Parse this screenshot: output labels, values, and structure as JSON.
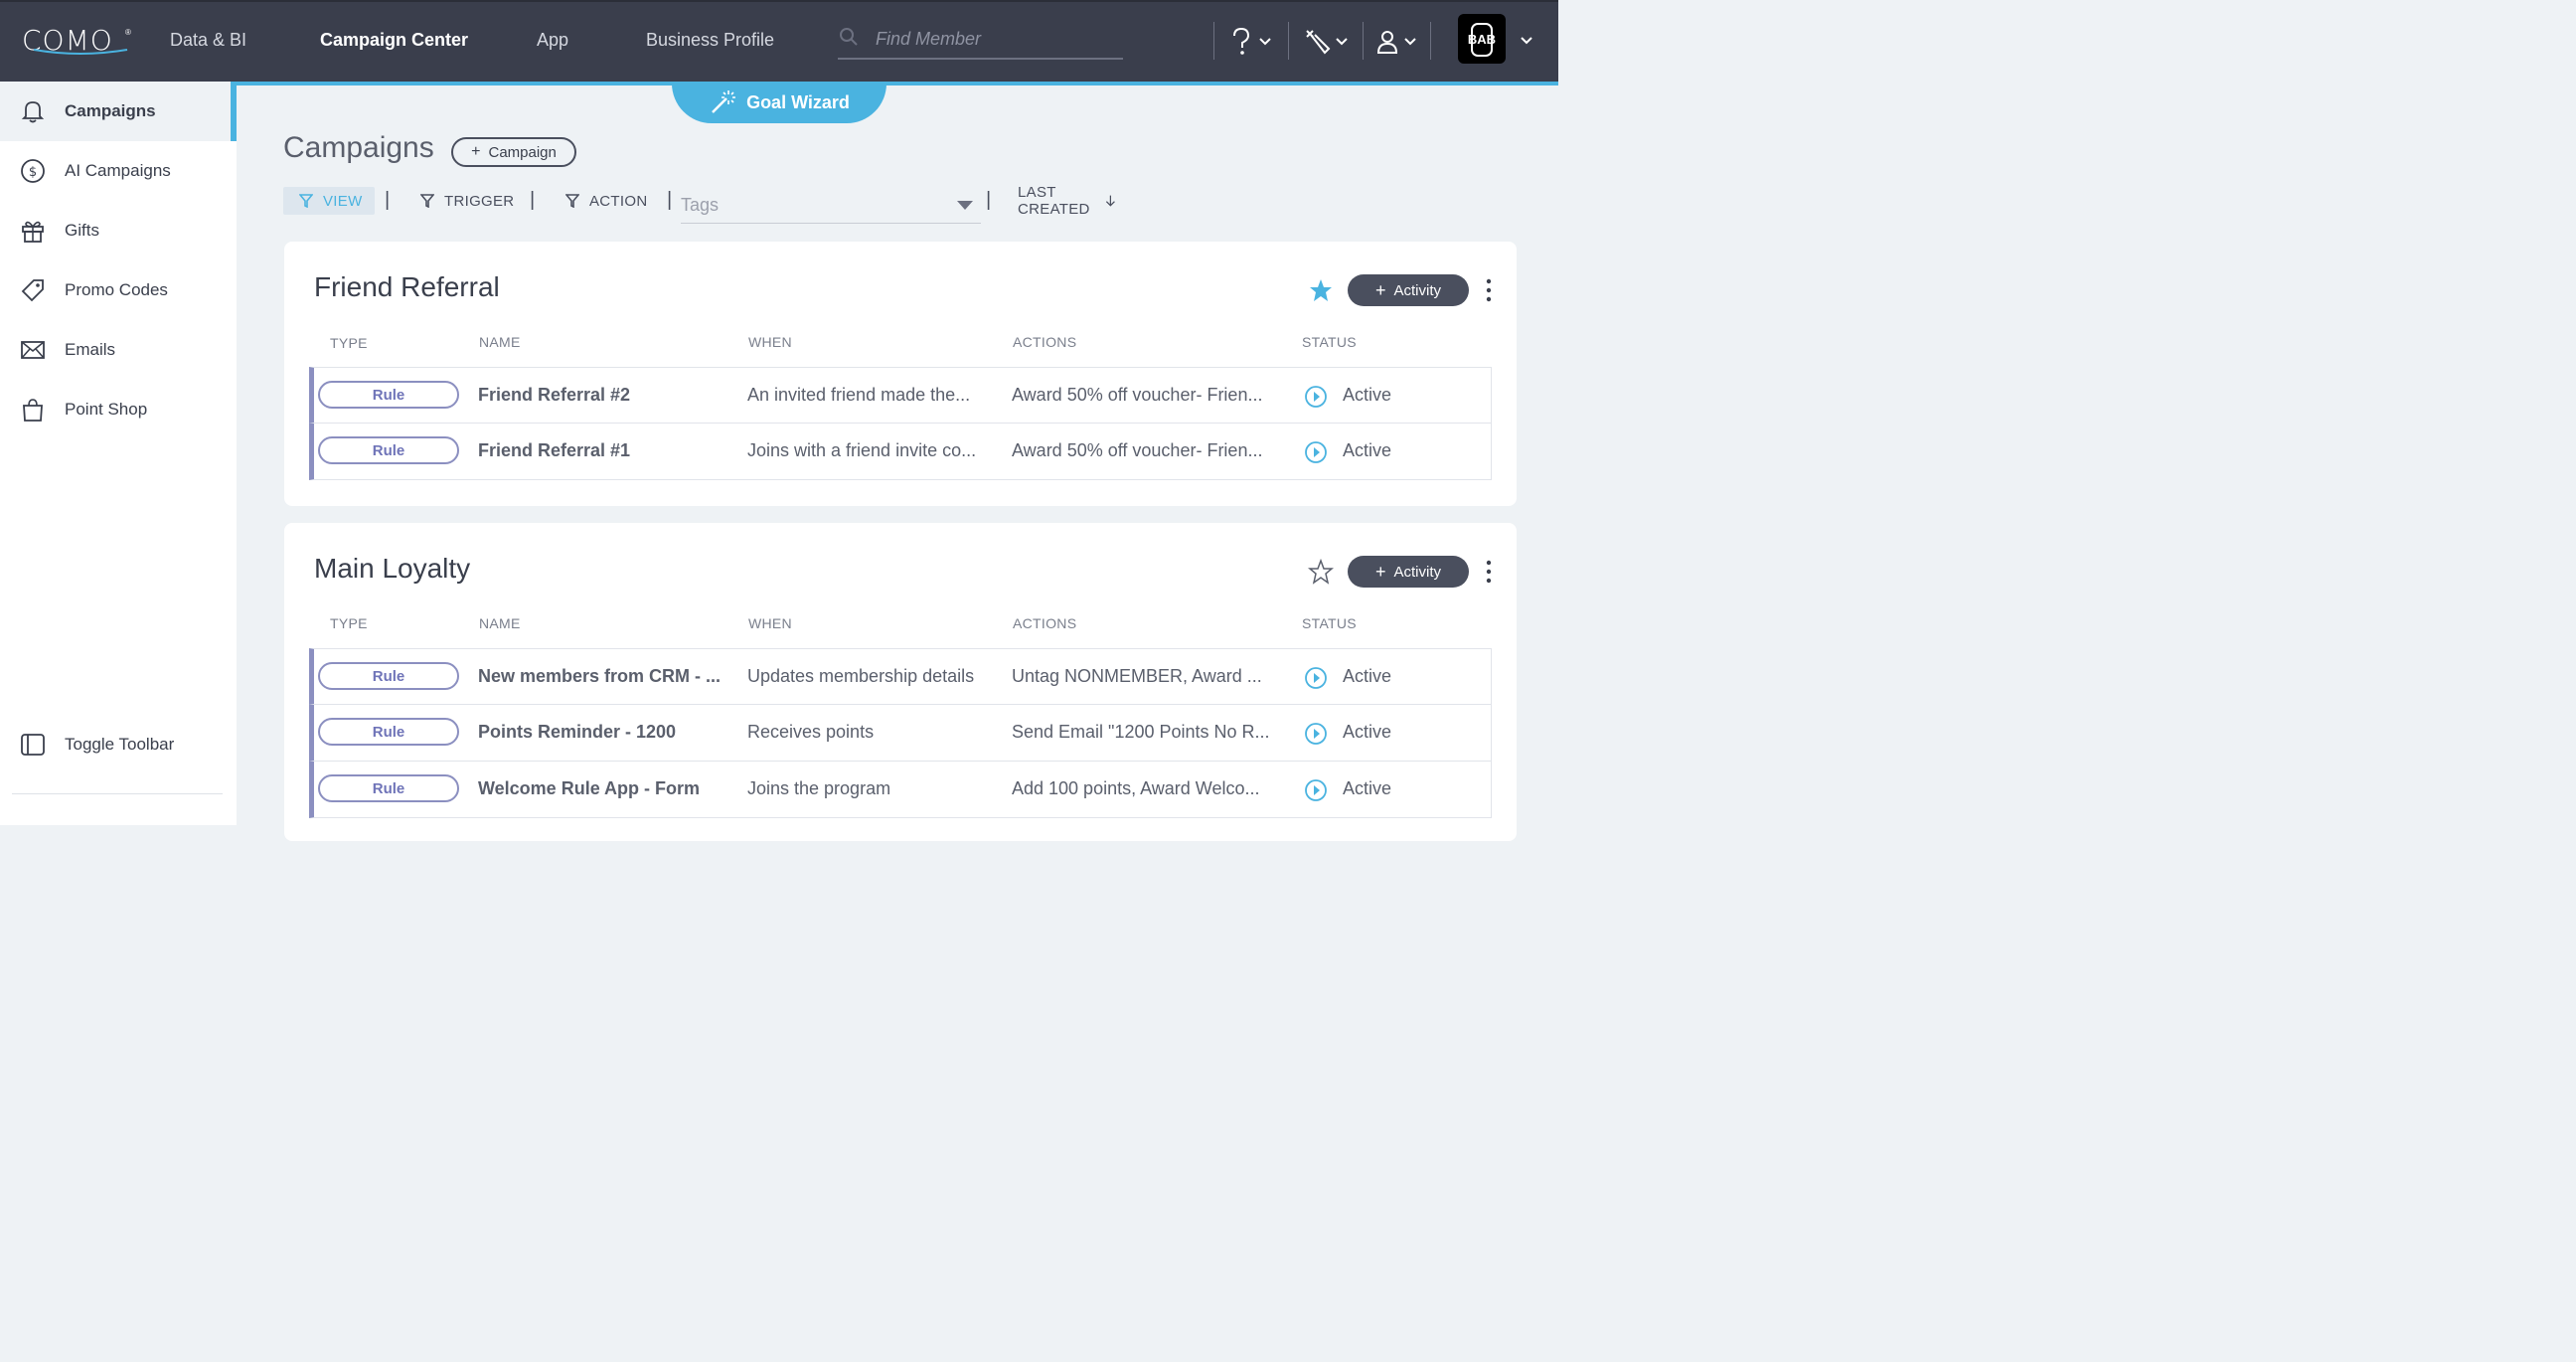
{
  "brand": {
    "logo": "COMO",
    "reg": "®",
    "account_badge": "BAB"
  },
  "nav": {
    "items": [
      {
        "label": "Data & BI"
      },
      {
        "label": "Campaign Center"
      },
      {
        "label": "App"
      },
      {
        "label": "Business Profile"
      }
    ],
    "search_placeholder": "Find Member",
    "icons": [
      "help-icon",
      "tools-icon",
      "user-icon"
    ]
  },
  "sidebar": {
    "items": [
      {
        "label": "Campaigns",
        "icon": "bell-icon"
      },
      {
        "label": "AI Campaigns",
        "icon": "dollar-circle-icon"
      },
      {
        "label": "Gifts",
        "icon": "gift-icon"
      },
      {
        "label": "Promo Codes",
        "icon": "tag-icon"
      },
      {
        "label": "Emails",
        "icon": "envelope-icon"
      },
      {
        "label": "Point Shop",
        "icon": "shopping-bag-icon"
      }
    ],
    "toggle_label": "Toggle Toolbar"
  },
  "goal_wizard": {
    "label": "Goal Wizard"
  },
  "page": {
    "title": "Campaigns",
    "add_button": "Campaign",
    "filters": {
      "view": "VIEW",
      "trigger": "TRIGGER",
      "action": "ACTION",
      "tags_placeholder": "Tags",
      "sort": "LAST CREATED"
    }
  },
  "columns": {
    "type": "TYPE",
    "name": "NAME",
    "when": "WHEN",
    "actions": "ACTIONS",
    "status": "STATUS"
  },
  "activity_label": "Activity",
  "campaigns": [
    {
      "title": "Friend Referral",
      "starred": true,
      "rows": [
        {
          "type": "Rule",
          "name": "Friend Referral #2",
          "when": "An invited friend made the...",
          "actions": "Award 50% off voucher- Frien...",
          "status": "Active"
        },
        {
          "type": "Rule",
          "name": "Friend Referral #1",
          "when": "Joins with a friend invite co...",
          "actions": "Award 50% off voucher- Frien...",
          "status": "Active"
        }
      ]
    },
    {
      "title": "Main Loyalty",
      "starred": false,
      "rows": [
        {
          "type": "Rule",
          "name": "New members from CRM - ...",
          "when": "Updates membership details",
          "actions": "Untag NONMEMBER, Award ...",
          "status": "Active"
        },
        {
          "type": "Rule",
          "name": "Points Reminder - 1200",
          "when": "Receives points",
          "actions": "Send Email \"1200 Points No R...",
          "status": "Active"
        },
        {
          "type": "Rule",
          "name": "Welcome Rule App - Form",
          "when": "Joins the program",
          "actions": "Add 100 points, Award Welco...",
          "status": "Active"
        }
      ]
    }
  ],
  "colors": {
    "topbar": "#3a3e4c",
    "accent": "#4ab3e0",
    "rule": "#8b8fc0"
  }
}
